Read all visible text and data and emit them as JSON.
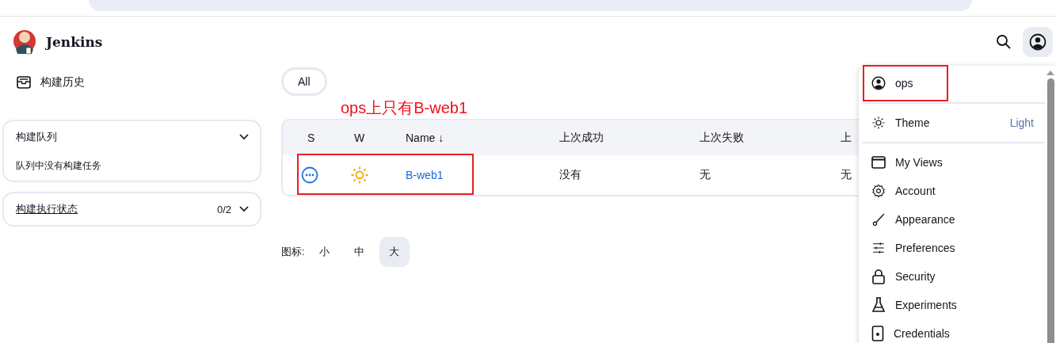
{
  "header": {
    "title": "Jenkins"
  },
  "sidebar": {
    "items": [
      {
        "label": "构建历史"
      }
    ],
    "panels": [
      {
        "title": "构建队列",
        "body": "队列中没有构建任务"
      },
      {
        "title": "构建执行状态",
        "count": "0/2",
        "link": true
      }
    ]
  },
  "view_tabs": [
    {
      "label": "All",
      "selected": true
    }
  ],
  "annotation": {
    "text": "ops上只有B-web1"
  },
  "table": {
    "columns": [
      "S",
      "W",
      "Name ↓",
      "上次成功",
      "上次失败",
      "上"
    ],
    "rows": [
      {
        "name": "B-web1",
        "last_success": "没有",
        "last_failure": "无",
        "column_6": "无",
        "annotated": true
      }
    ]
  },
  "icon_size": {
    "label": "图标:",
    "options": [
      {
        "label": "小",
        "selected": false
      },
      {
        "label": "中",
        "selected": false
      },
      {
        "label": "大",
        "selected": true
      }
    ]
  },
  "user_menu": {
    "sections": [
      [
        {
          "kind": "user",
          "label": "ops",
          "annotated": true
        }
      ],
      [
        {
          "kind": "theme",
          "label": "Theme",
          "value": "Light"
        }
      ],
      [
        {
          "kind": "views",
          "label": "My Views"
        },
        {
          "kind": "account",
          "label": "Account"
        },
        {
          "kind": "appearance",
          "label": "Appearance"
        },
        {
          "kind": "preferences",
          "label": "Preferences"
        },
        {
          "kind": "security",
          "label": "Security"
        },
        {
          "kind": "experiments",
          "label": "Experiments"
        },
        {
          "kind": "credentials",
          "label": "Credentials"
        }
      ]
    ]
  }
}
